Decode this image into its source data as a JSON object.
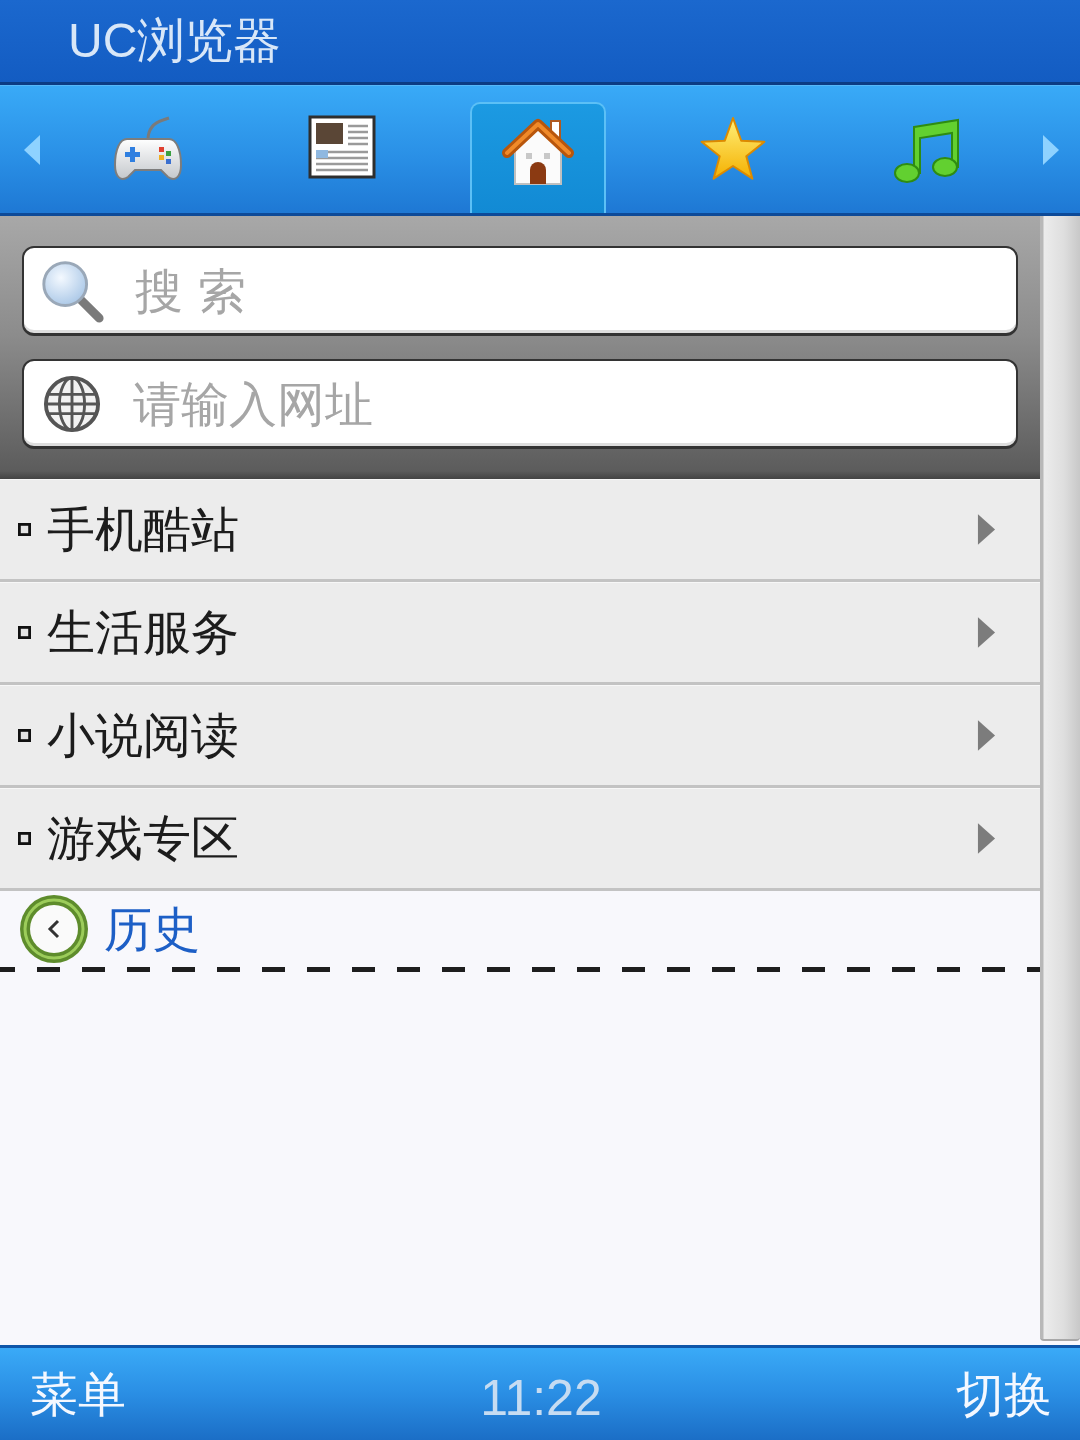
{
  "window": {
    "title": "UC浏览器"
  },
  "tabs": [
    {
      "kind": "games",
      "selected": false
    },
    {
      "kind": "news",
      "selected": false
    },
    {
      "kind": "home",
      "selected": true
    },
    {
      "kind": "favorites",
      "selected": false
    },
    {
      "kind": "music",
      "selected": false
    }
  ],
  "search_field": {
    "placeholder": "搜 索"
  },
  "address_field": {
    "placeholder": "请输入网址"
  },
  "menu_items": [
    {
      "label": "手机酷站"
    },
    {
      "label": "生活服务"
    },
    {
      "label": "小说阅读"
    },
    {
      "label": "游戏专区"
    }
  ],
  "history": {
    "label": "历史"
  },
  "status_bar": {
    "left_softkey": "菜单",
    "time": "11:22",
    "right_softkey": "切换"
  }
}
